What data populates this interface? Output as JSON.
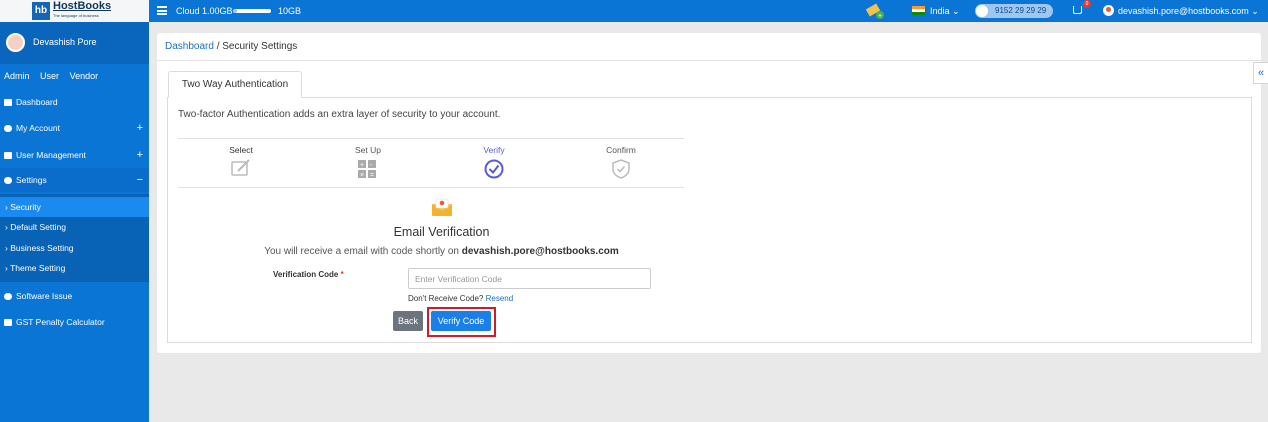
{
  "brand": {
    "logo_mark": "hb",
    "name": "HostBooks",
    "tagline": "The language of business"
  },
  "topbar": {
    "storage_label": "Cloud 1.00GB",
    "storage_max": "10GB",
    "storage_used_fraction": 0.1,
    "country": "India",
    "phone": "9152 29 29 29",
    "cart_count": "0",
    "user_email": "devashish.pore@hostbooks.com",
    "accent_color": "#0b75d6"
  },
  "sidebar": {
    "user_name": "Devashish Pore",
    "roles": [
      "Admin",
      "User",
      "Vendor"
    ],
    "items": [
      {
        "label": "Dashboard",
        "icon": "dashboard-icon"
      },
      {
        "label": "My Account",
        "icon": "user-circle-icon",
        "expand": "+"
      },
      {
        "label": "User Management",
        "icon": "users-icon",
        "expand": "+"
      },
      {
        "label": "Settings",
        "icon": "gear-icon",
        "expand": "−"
      }
    ],
    "settings_sub": [
      {
        "label": "Security"
      },
      {
        "label": "Default Setting"
      },
      {
        "label": "Business Setting"
      },
      {
        "label": "Theme Setting"
      }
    ],
    "bottom_items": [
      {
        "label": "Software Issue",
        "icon": "info-icon"
      },
      {
        "label": "GST Penalty Calculator",
        "icon": "calculator-icon"
      }
    ]
  },
  "breadcrumb": {
    "root": "Dashboard",
    "separator": " / ",
    "current": "Security Settings"
  },
  "tab": {
    "label": "Two Way Authentication"
  },
  "content": {
    "description": "Two-factor Authentication adds an extra layer of security to your account.",
    "steps": [
      {
        "label": "Select",
        "icon": "edit-icon"
      },
      {
        "label": "Set Up",
        "icon": "grid-icon"
      },
      {
        "label": "Verify",
        "icon": "check-circle-icon",
        "active": true
      },
      {
        "label": "Confirm",
        "icon": "shield-check-icon"
      }
    ],
    "title": "Email Verification",
    "desc_prefix": "You will receive a email with code shortly on",
    "desc_email": "devashish.pore@hostbooks.com",
    "code_label": "Verification Code",
    "required_mark": "*",
    "code_placeholder": "Enter Verification Code",
    "code_value": "",
    "no_code_text": "Don't Receive Code?",
    "resend_label": "Resend",
    "back_label": "Back",
    "verify_label": "Verify Code"
  },
  "collapse_glyph": "«"
}
